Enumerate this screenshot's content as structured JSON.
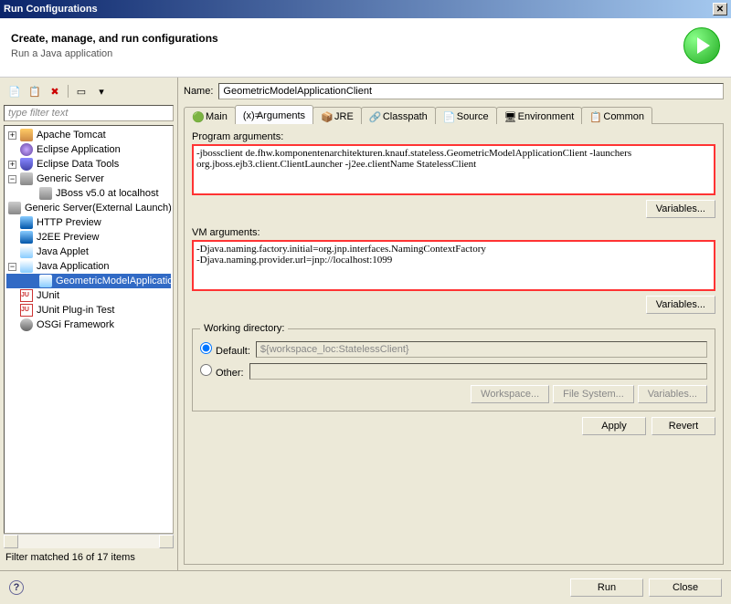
{
  "window": {
    "title": "Run Configurations"
  },
  "header": {
    "title": "Create, manage, and run configurations",
    "subtitle": "Run a Java application"
  },
  "filter": {
    "placeholder": "type filter text"
  },
  "tree": {
    "nodes": [
      {
        "label": "Apache Tomcat",
        "icon": "tomcat",
        "expandable": true,
        "expanded": false
      },
      {
        "label": "Eclipse Application",
        "icon": "eclipse",
        "expandable": false
      },
      {
        "label": "Eclipse Data Tools",
        "icon": "db",
        "expandable": true,
        "expanded": false
      },
      {
        "label": "Generic Server",
        "icon": "server",
        "expandable": true,
        "expanded": true,
        "children": [
          {
            "label": "JBoss v5.0 at localhost"
          }
        ]
      },
      {
        "label": "Generic Server(External Launch)",
        "icon": "server",
        "expandable": false
      },
      {
        "label": "HTTP Preview",
        "icon": "j2ee",
        "expandable": false
      },
      {
        "label": "J2EE Preview",
        "icon": "j2ee",
        "expandable": false
      },
      {
        "label": "Java Applet",
        "icon": "java",
        "expandable": false
      },
      {
        "label": "Java Application",
        "icon": "java",
        "expandable": true,
        "expanded": true,
        "children": [
          {
            "label": "GeometricModelApplicationClient",
            "selected": true
          }
        ]
      },
      {
        "label": "JUnit",
        "icon": "junit",
        "expandable": false
      },
      {
        "label": "JUnit Plug-in Test",
        "icon": "junit",
        "expandable": false
      },
      {
        "label": "OSGi Framework",
        "icon": "osgi",
        "expandable": false
      }
    ]
  },
  "filter_status": "Filter matched 16 of 17 items",
  "form": {
    "name_label": "Name:",
    "name_value": "GeometricModelApplicationClient"
  },
  "tabs": [
    {
      "label": "Main",
      "icon": "green-circle"
    },
    {
      "label": "Arguments",
      "icon": "args",
      "active": true
    },
    {
      "label": "JRE",
      "icon": "jre"
    },
    {
      "label": "Classpath",
      "icon": "classpath"
    },
    {
      "label": "Source",
      "icon": "source"
    },
    {
      "label": "Environment",
      "icon": "env"
    },
    {
      "label": "Common",
      "icon": "common"
    }
  ],
  "arguments": {
    "program_label": "Program arguments:",
    "program_value": "-jbossclient de.fhw.komponentenarchitekturen.knauf.stateless.GeometricModelApplicationClient -launchers org.jboss.ejb3.client.ClientLauncher -j2ee.clientName StatelessClient",
    "vm_label": "VM arguments:",
    "vm_value": "-Djava.naming.factory.initial=org.jnp.interfaces.NamingContextFactory\n-Djava.naming.provider.url=jnp://localhost:1099",
    "variables_btn": "Variables..."
  },
  "working_dir": {
    "legend": "Working directory:",
    "default_label": "Default:",
    "default_value": "${workspace_loc:StatelessClient}",
    "other_label": "Other:",
    "workspace_btn": "Workspace...",
    "filesystem_btn": "File System...",
    "variables_btn": "Variables..."
  },
  "buttons": {
    "apply": "Apply",
    "revert": "Revert",
    "run": "Run",
    "close": "Close"
  }
}
